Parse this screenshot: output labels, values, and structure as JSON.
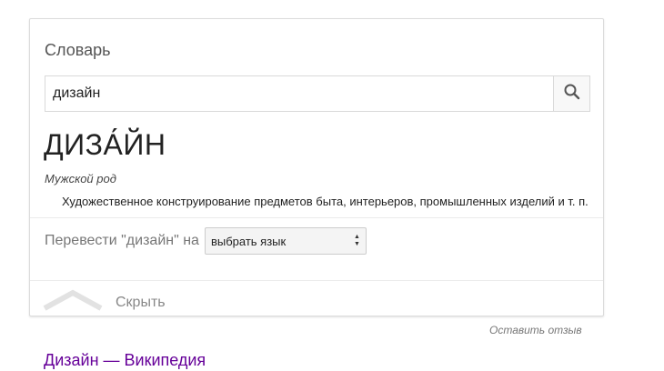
{
  "dictionary": {
    "title": "Словарь",
    "search": {
      "value": "дизайн",
      "button_icon": "search-icon"
    },
    "entry": {
      "headword": "ДИЗА́ЙН",
      "part_of_speech": "Мужской род",
      "definition": "Художественное конструирование предметов быта, интерьеров, промышленных изделий и т. п."
    },
    "translate": {
      "label": "Перевести \"дизайн\" на",
      "selected_option": "выбрать язык"
    },
    "collapse": {
      "label": "Скрыть",
      "icon": "chevron-up-icon"
    }
  },
  "feedback": {
    "label": "Оставить отзыв"
  },
  "result_link": {
    "label": "Дизайн — Википедия"
  },
  "colors": {
    "link": "#660099",
    "border": "#dcdcdc",
    "muted_text": "#777777"
  }
}
